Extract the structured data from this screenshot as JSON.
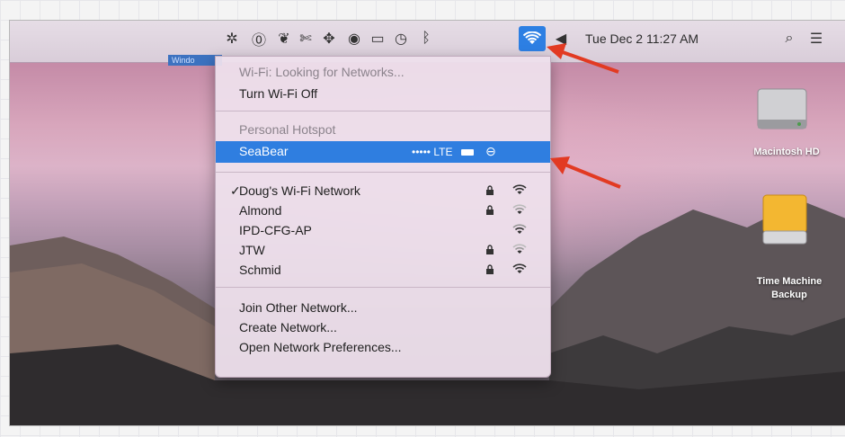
{
  "window_tab": "Windo",
  "menubar": {
    "icons": [
      "gremlin-icon",
      "one-password-icon",
      "evernote-icon",
      "crossover-icon",
      "network-icon",
      "record-icon",
      "airplay-icon",
      "time-machine-icon",
      "bluetooth-icon",
      "wifi-icon",
      "volume-icon",
      "search-icon",
      "list-icon"
    ],
    "clock": "Tue Dec 2  11:27 AM"
  },
  "wifi_menu": {
    "status": "Wi-Fi: Looking for Networks...",
    "toggle": "Turn Wi-Fi Off",
    "hotspot_header": "Personal Hotspot",
    "hotspot": {
      "name": "SeaBear",
      "signal": "•••••",
      "network_type": "LTE"
    },
    "networks": [
      {
        "name": "Doug's Wi-Fi Network",
        "checked": true,
        "locked": true
      },
      {
        "name": "Almond",
        "checked": false,
        "locked": true
      },
      {
        "name": "IPD-CFG-AP",
        "checked": false,
        "locked": false
      },
      {
        "name": "JTW",
        "checked": false,
        "locked": true
      },
      {
        "name": "Schmid",
        "checked": false,
        "locked": true
      }
    ],
    "actions": [
      "Join Other Network...",
      "Create Network...",
      "Open Network Preferences..."
    ]
  },
  "desktop": {
    "disks": [
      {
        "label": "Macintosh HD",
        "label2": ""
      },
      {
        "label": "Time Machine",
        "label2": "Backup"
      }
    ]
  },
  "colors": {
    "highlight": "#2f7ee0",
    "arrow": "#e23a22"
  }
}
